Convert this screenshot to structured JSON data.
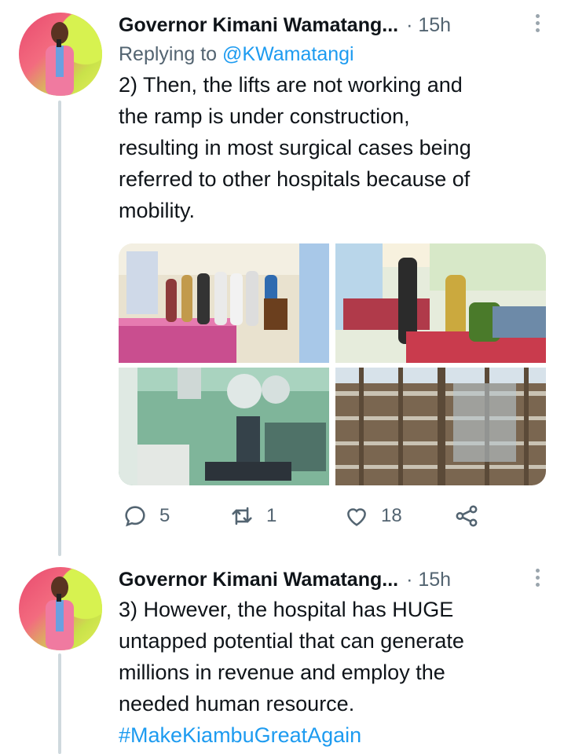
{
  "tweets": [
    {
      "author": "Governor Kimani Wamatang...",
      "time": "· 15h",
      "replying_prefix": "Replying to ",
      "replying_handle": "@KWamatangi",
      "text": "2) Then, the lifts are not working and\nthe ramp is under construction,\nresulting in most surgical cases being\nreferred to other hospitals because of\nmobility.",
      "actions": {
        "replies": "5",
        "retweets": "1",
        "likes": "18"
      }
    },
    {
      "author": "Governor Kimani Wamatang...",
      "time": "· 15h",
      "text": "3) However, the hospital has HUGE\nuntapped potential that can generate\nmillions in revenue and employ the\nneeded human resource.",
      "hashtag": "#MakeKiambuGreatAgain"
    }
  ],
  "colors": {
    "link": "#1d9bf0",
    "secondary": "#536471",
    "thread_line": "#cfd9de"
  },
  "icons": [
    "reply-icon",
    "retweet-icon",
    "like-icon",
    "share-icon",
    "more-icon"
  ]
}
